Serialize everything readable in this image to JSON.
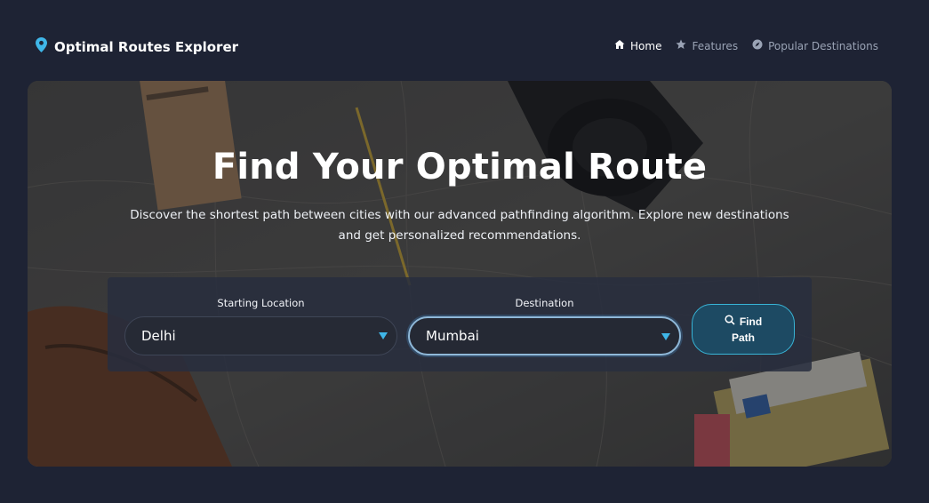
{
  "brand": {
    "title": "Optimal Routes Explorer",
    "icon": "map-pin-icon"
  },
  "nav": {
    "items": [
      {
        "label": "Home",
        "icon": "home-icon",
        "active": true
      },
      {
        "label": "Features",
        "icon": "star-icon",
        "active": false
      },
      {
        "label": "Popular Destinations",
        "icon": "compass-icon",
        "active": false
      }
    ]
  },
  "hero": {
    "title": "Find Your Optimal Route",
    "subtitle": "Discover the shortest path between cities with our advanced pathfinding algorithm. Explore new destinations and get personalized recommendations."
  },
  "search": {
    "start_label": "Starting Location",
    "start_value": "Delhi",
    "dest_label": "Destination",
    "dest_value": "Mumbai",
    "button_line1": "Find",
    "button_line2": "Path",
    "button_icon": "search-icon"
  },
  "colors": {
    "page_bg": "#1e2334",
    "accent": "#3fb6e8",
    "button_bg": "#1d4a63"
  }
}
